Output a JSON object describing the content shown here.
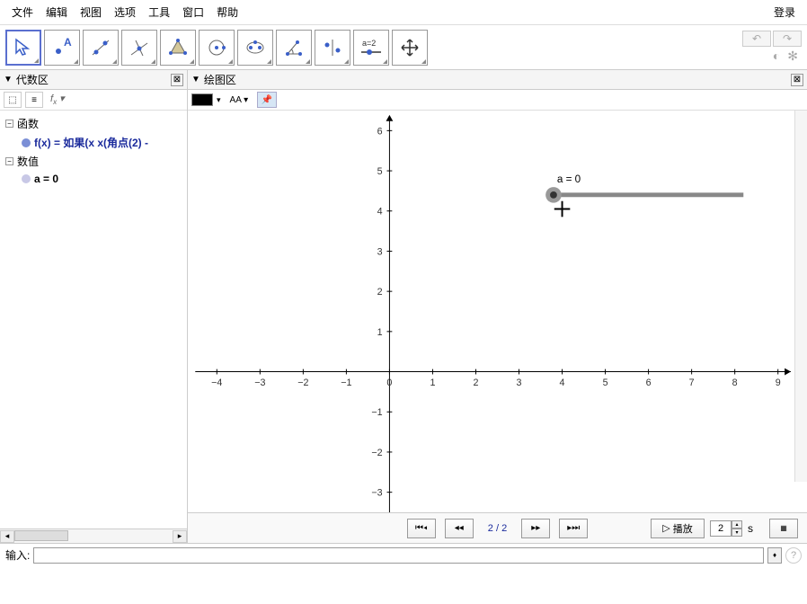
{
  "menu": {
    "items": [
      "文件",
      "编辑",
      "视图",
      "选项",
      "工具",
      "窗口",
      "帮助"
    ],
    "login": "登录"
  },
  "toolbar": {
    "tools": [
      "move",
      "point",
      "line",
      "perpendicular",
      "polygon",
      "circle",
      "ellipse",
      "angle",
      "reflect",
      "slider",
      "translate"
    ],
    "active_index": 0,
    "slider_label": "a=2"
  },
  "panels": {
    "algebra": {
      "title": "代数区",
      "fx_label": "fx",
      "categories": [
        {
          "name": "函数",
          "items": [
            {
              "label": "f(x) = 如果(x x(角点(2) -",
              "color": "#7b8fd6",
              "type": "fn"
            }
          ]
        },
        {
          "name": "数值",
          "items": [
            {
              "label": "a = 0",
              "color": "#c8c8e6",
              "type": "val"
            }
          ]
        }
      ]
    },
    "graphics": {
      "title": "绘图区",
      "font_label": "AA"
    }
  },
  "chart_data": {
    "type": "line",
    "title": "",
    "xlabel": "",
    "ylabel": "",
    "xlim": [
      -4.5,
      9.5
    ],
    "ylim": [
      -3.5,
      6.5
    ],
    "x_ticks": [
      -4,
      -3,
      -2,
      -1,
      0,
      1,
      2,
      3,
      4,
      5,
      6,
      7,
      8,
      9
    ],
    "y_ticks": [
      -3,
      -2,
      -1,
      1,
      2,
      3,
      4,
      5,
      6
    ],
    "slider": {
      "label": "a = 0",
      "x_start": 3.8,
      "x_end": 8.2,
      "y": 4.4,
      "handle_x": 3.8
    },
    "cursor": {
      "x": 4.0,
      "y": 4.05
    }
  },
  "navigation": {
    "current": 2,
    "total": 2,
    "separator": "/",
    "play_label": "播放",
    "speed_value": "2",
    "speed_unit": "s"
  },
  "input": {
    "label": "输入:",
    "value": ""
  },
  "colors": {
    "accent": "#1a2a9c",
    "slider_track": "#888888",
    "slider_handle_outer": "#999999",
    "slider_handle_inner": "#333333"
  }
}
